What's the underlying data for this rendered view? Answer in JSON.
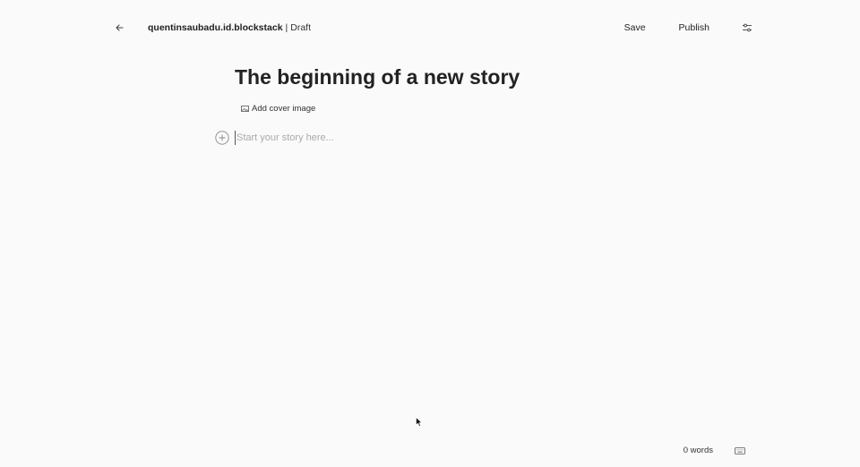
{
  "header": {
    "back_icon": "arrow-left-icon",
    "author": "quentinsaubadu.id.blockstack",
    "separator": "|",
    "status": "Draft",
    "save_label": "Save",
    "publish_label": "Publish",
    "settings_icon": "sliders-icon"
  },
  "editor": {
    "title": "The beginning of a new story",
    "cover_label": "Add cover image",
    "cover_icon": "image-icon",
    "add_icon": "plus-circle-icon",
    "placeholder": "Start your story here..."
  },
  "footer": {
    "word_count": "0 words",
    "keyboard_icon": "keyboard-icon"
  },
  "colors": {
    "background": "#fafafa",
    "text": "#222222",
    "placeholder": "#aaaaaa"
  }
}
